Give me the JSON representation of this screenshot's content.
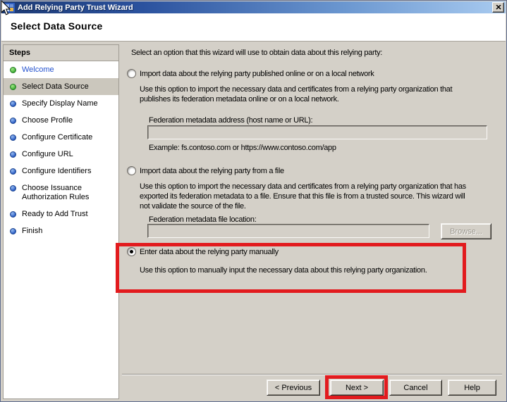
{
  "window": {
    "title": "Add Relying Party Trust Wizard"
  },
  "icons": {
    "close": "close-x-icon",
    "window": "wizard-grid-icon",
    "cursor": "mouse-arrow-pointer-icon"
  },
  "header": {
    "title": "Select Data Source"
  },
  "sidebar": {
    "title": "Steps",
    "steps": [
      {
        "label": "Welcome",
        "status": "completed"
      },
      {
        "label": "Select Data Source",
        "status": "current"
      },
      {
        "label": "Specify Display Name",
        "status": "upcoming"
      },
      {
        "label": "Choose Profile",
        "status": "upcoming"
      },
      {
        "label": "Configure Certificate",
        "status": "upcoming"
      },
      {
        "label": "Configure URL",
        "status": "upcoming"
      },
      {
        "label": "Configure Identifiers",
        "status": "upcoming"
      },
      {
        "label": "Choose Issuance Authorization Rules",
        "status": "upcoming"
      },
      {
        "label": "Ready to Add Trust",
        "status": "upcoming"
      },
      {
        "label": "Finish",
        "status": "upcoming"
      }
    ]
  },
  "main": {
    "instruction": "Select an option that this wizard will use to obtain data about this relying party:",
    "options": [
      {
        "label": "Import data about the relying party published online or on a local network",
        "selected": false,
        "description": "Use this option to import the necessary data and certificates from a relying party organization that\npublishes its federation metadata online or on a local network.",
        "field_label": "Federation metadata address (host name or URL):",
        "field_value": "",
        "example": "Example: fs.contoso.com or https://www.contoso.com/app"
      },
      {
        "label": "Import data about the relying party from a file",
        "selected": false,
        "description": "Use this option to import the necessary data and certificates from a relying party organization that has\nexported its federation metadata to a file. Ensure that this file is from a trusted source.  This wizard will\nnot validate the source of the file.",
        "field_label": "Federation metadata file location:",
        "field_value": "",
        "browse_label": "Browse..."
      },
      {
        "label": "Enter data about the relying party manually",
        "selected": true,
        "description": "Use this option to manually input the necessary data about this relying party organization."
      }
    ]
  },
  "footer": {
    "previous_label": "< Previous",
    "next_label": "Next >",
    "cancel_label": "Cancel",
    "help_label": "Help"
  },
  "colors": {
    "dialog_bg": "#d4d0c8",
    "highlight_red": "#e21b1e",
    "selected_step_bg": "#cbc7bd",
    "link_blue": "#2553cf",
    "step_done_green": "#39a832",
    "step_upcoming_blue": "#2356c0",
    "titlebar_gradient_start": "#1d3a74",
    "titlebar_gradient_end": "#a9cbf0"
  }
}
